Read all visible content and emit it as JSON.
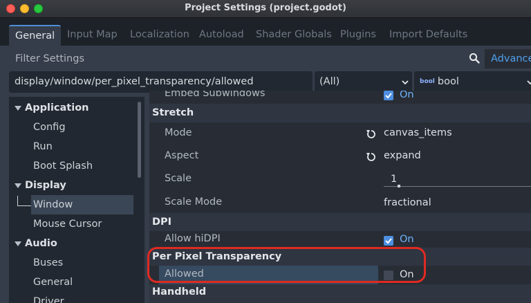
{
  "window": {
    "title": "Project Settings (project.godot)"
  },
  "tabs": [
    {
      "label": "General",
      "active": true
    },
    {
      "label": "Input Map"
    },
    {
      "label": "Localization"
    },
    {
      "label": "Autoload"
    },
    {
      "label": "Shader Globals"
    },
    {
      "label": "Plugins"
    },
    {
      "label": "Import Defaults"
    }
  ],
  "filter": {
    "placeholder": "Filter Settings",
    "advanced_label": "Advanced"
  },
  "path_bar": {
    "path": "display/window/per_pixel_transparency/allowed",
    "feature_select": "(All)",
    "type_badge": "bool",
    "type_select": "bool"
  },
  "sidebar": {
    "items": [
      {
        "label": "Application",
        "kind": "section"
      },
      {
        "label": "Config"
      },
      {
        "label": "Run"
      },
      {
        "label": "Boot Splash"
      },
      {
        "label": "Display",
        "kind": "section"
      },
      {
        "label": "Window",
        "selected": true
      },
      {
        "label": "Mouse Cursor"
      },
      {
        "label": "Audio",
        "kind": "section"
      },
      {
        "label": "Buses"
      },
      {
        "label": "General"
      },
      {
        "label": "Driver"
      }
    ]
  },
  "inspector": {
    "embed_subwindows": {
      "label": "Embed Subwindows",
      "value": "On"
    },
    "stretch": {
      "title": "Stretch",
      "mode": {
        "label": "Mode",
        "value": "canvas_items"
      },
      "aspect": {
        "label": "Aspect",
        "value": "expand"
      },
      "scale": {
        "label": "Scale",
        "value": "1"
      },
      "scale_mode": {
        "label": "Scale Mode",
        "value": "fractional"
      }
    },
    "dpi": {
      "title": "DPI",
      "allow_hidpi": {
        "label": "Allow hiDPI",
        "value": "On"
      }
    },
    "per_pixel_transparency": {
      "title": "Per Pixel Transparency",
      "allowed": {
        "label": "Allowed",
        "value": "On"
      }
    },
    "handheld": {
      "title": "Handheld"
    }
  },
  "colors": {
    "accent": "#4ea1f0",
    "highlight_annotation": "#e02a22"
  }
}
